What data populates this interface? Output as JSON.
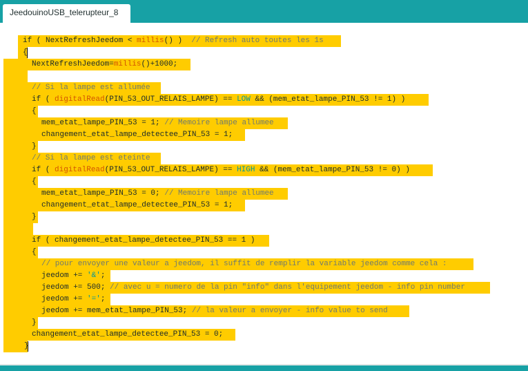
{
  "tab": {
    "title": "JeedouinoUSB_telerupteur_8"
  },
  "code_lines": [
    {
      "segs": [
        [
          "plain",
          "if ( NextRefreshJeedom < "
        ],
        [
          "kw",
          "millis"
        ],
        [
          "plain",
          "() )  "
        ],
        [
          "cm",
          "// Refresh auto toutes les 1s"
        ]
      ]
    },
    {
      "segs": [
        [
          "plain",
          "{"
        ]
      ]
    },
    {
      "segs": [
        [
          "plain",
          "NextRefreshJeedom="
        ],
        [
          "kw",
          "millis"
        ],
        [
          "plain",
          "()+1000;"
        ]
      ]
    },
    {
      "segs": []
    },
    {
      "segs": [
        [
          "cm",
          "// Si la lampe est allumée"
        ]
      ]
    },
    {
      "segs": [
        [
          "plain",
          "if ( "
        ],
        [
          "kw",
          "digitalRead"
        ],
        [
          "plain",
          "(PIN_53_OUT_RELAIS_LAMPE) == "
        ],
        [
          "const",
          "LOW"
        ],
        [
          "plain",
          " && (mem_etat_lampe_PIN_53 != 1) )"
        ]
      ]
    },
    {
      "segs": [
        [
          "plain",
          "{"
        ]
      ]
    },
    {
      "segs": [
        [
          "plain",
          "mem_etat_lampe_PIN_53 = 1; "
        ],
        [
          "cm",
          "// Memoire lampe allumee"
        ]
      ]
    },
    {
      "segs": [
        [
          "plain",
          "changement_etat_lampe_detectee_PIN_53 = 1;"
        ]
      ]
    },
    {
      "segs": [
        [
          "plain",
          "}"
        ]
      ]
    },
    {
      "segs": [
        [
          "cm",
          "// Si la lampe est eteinte"
        ]
      ]
    },
    {
      "segs": [
        [
          "plain",
          "if ( "
        ],
        [
          "kw",
          "digitalRead"
        ],
        [
          "plain",
          "(PIN_53_OUT_RELAIS_LAMPE) == "
        ],
        [
          "const",
          "HIGH"
        ],
        [
          "plain",
          " && (mem_etat_lampe_PIN_53 != 0) )"
        ]
      ]
    },
    {
      "segs": [
        [
          "plain",
          "{"
        ]
      ]
    },
    {
      "segs": [
        [
          "plain",
          "mem_etat_lampe_PIN_53 = 0; "
        ],
        [
          "cm",
          "// Memoire lampe allumee"
        ]
      ]
    },
    {
      "segs": [
        [
          "plain",
          "changement_etat_lampe_detectee_PIN_53 = 1;"
        ]
      ]
    },
    {
      "segs": [
        [
          "plain",
          "}"
        ]
      ]
    },
    {
      "segs": []
    },
    {
      "segs": [
        [
          "plain",
          "if ( changement_etat_lampe_detectee_PIN_53 == 1 )"
        ]
      ]
    },
    {
      "segs": [
        [
          "plain",
          "{"
        ]
      ]
    },
    {
      "segs": [
        [
          "cm",
          "// pour envoyer une valeur a jeedom, il suffit de remplir la variable jeedom comme cela :"
        ]
      ]
    },
    {
      "segs": [
        [
          "plain",
          "jeedom += "
        ],
        [
          "const",
          "'&'"
        ],
        [
          "plain",
          ";"
        ]
      ]
    },
    {
      "segs": [
        [
          "plain",
          "jeedom += 500; "
        ],
        [
          "cm",
          "// avec u = numero de la pin \"info\" dans l'equipement jeedom - info pin number"
        ]
      ]
    },
    {
      "segs": [
        [
          "plain",
          "jeedom += "
        ],
        [
          "const",
          "'='"
        ],
        [
          "plain",
          ";"
        ]
      ]
    },
    {
      "segs": [
        [
          "plain",
          "jeedom += mem_etat_lampe_PIN_53; "
        ],
        [
          "cm",
          "// la valeur a envoyer - info value to send"
        ]
      ]
    },
    {
      "segs": [
        [
          "plain",
          "}"
        ]
      ]
    },
    {
      "segs": [
        [
          "plain",
          "changement_etat_lampe_detectee_PIN_53 = 0;"
        ]
      ]
    },
    {
      "segs": [
        [
          "plain",
          "}"
        ]
      ]
    }
  ]
}
